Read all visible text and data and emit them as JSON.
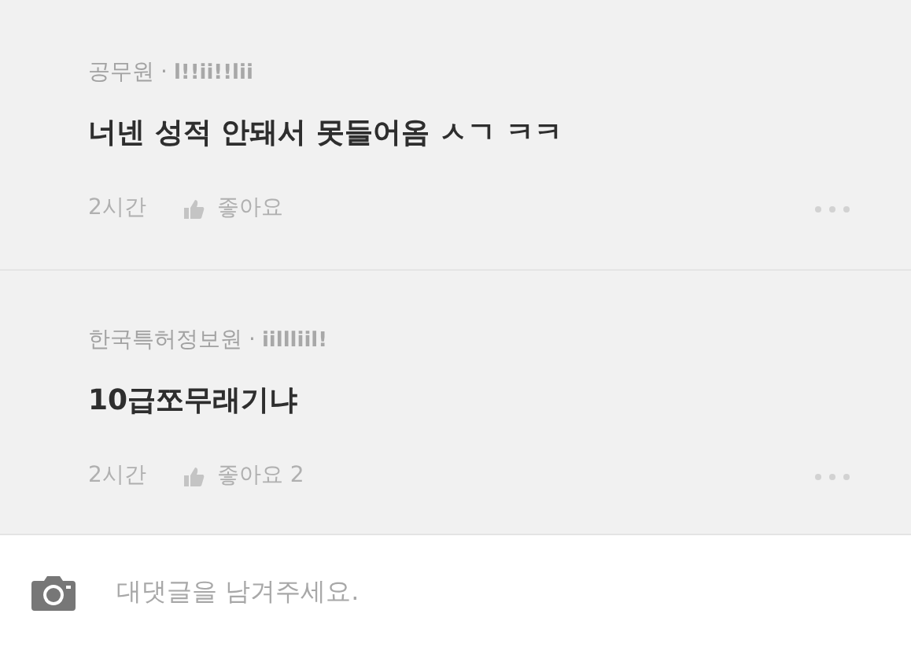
{
  "comments": [
    {
      "author": "공무원",
      "separator": "·",
      "nickname": "l!!ii!!lii",
      "text": "너넨 성적 안돼서 못들어옴 ㅅㄱ ㅋㅋ",
      "time": "2시간",
      "like_label": "좋아요"
    },
    {
      "author": "한국특허정보원",
      "separator": "·",
      "nickname": "iillliil!",
      "text": "10급쪼무래기냐",
      "time": "2시간",
      "like_label": "좋아요 2"
    }
  ],
  "reply_input": {
    "placeholder": "대댓글을 남겨주세요."
  }
}
